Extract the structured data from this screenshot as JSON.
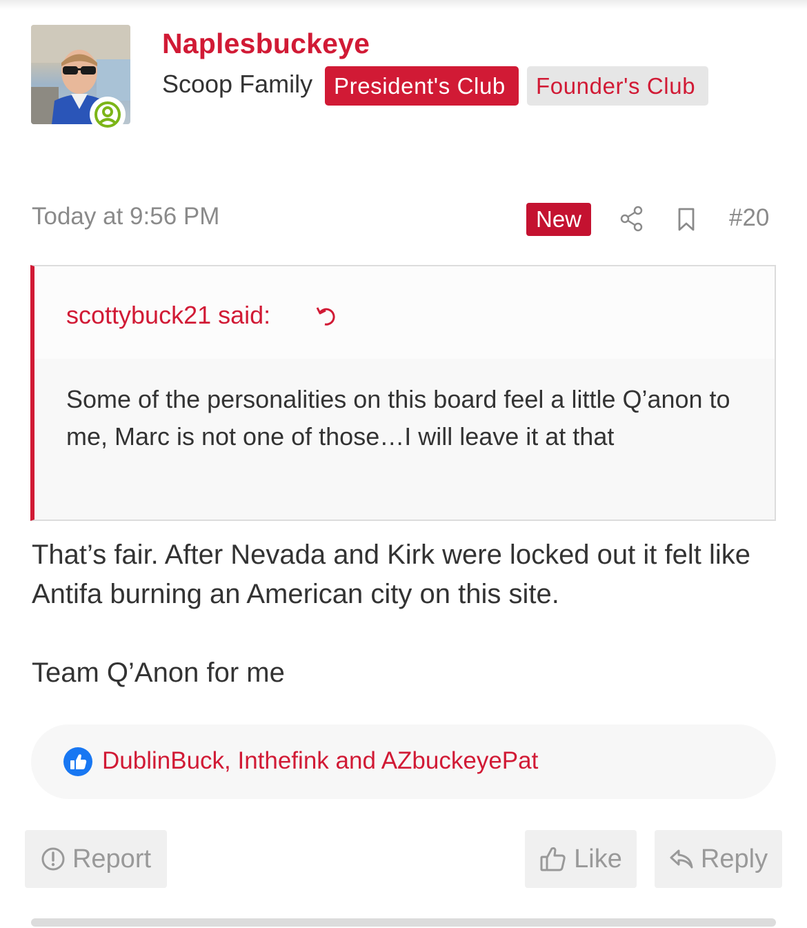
{
  "post": {
    "username": "Naplesbuckeye",
    "user_title": "Scoop Family",
    "banners": [
      "President's Club",
      "Founder's Club"
    ],
    "date": "Today at 9:56 PM",
    "new_label": "New",
    "post_number": "#20",
    "quote": {
      "author_label": "scottybuck21 said:",
      "text": "Some of the personalities on this board feel a little Q’anon to me, Marc is not one of those…I will leave it at that"
    },
    "body_paragraphs": [
      "That’s fair. After Nevada and Kirk were locked out it felt like Antifa burning an American city on this site.",
      "Team Q’Anon for me"
    ],
    "reactions": {
      "icon": "thumbs-up-icon",
      "users_text": "DublinBuck, Inthefink and AZbuckeyePat"
    },
    "actions": {
      "report": "Report",
      "like": "Like",
      "reply": "Reply"
    }
  },
  "colors": {
    "brand_red": "#d11a35",
    "new_badge": "#c41230",
    "online_green": "#7cb518",
    "reaction_blue": "#1877f2"
  }
}
